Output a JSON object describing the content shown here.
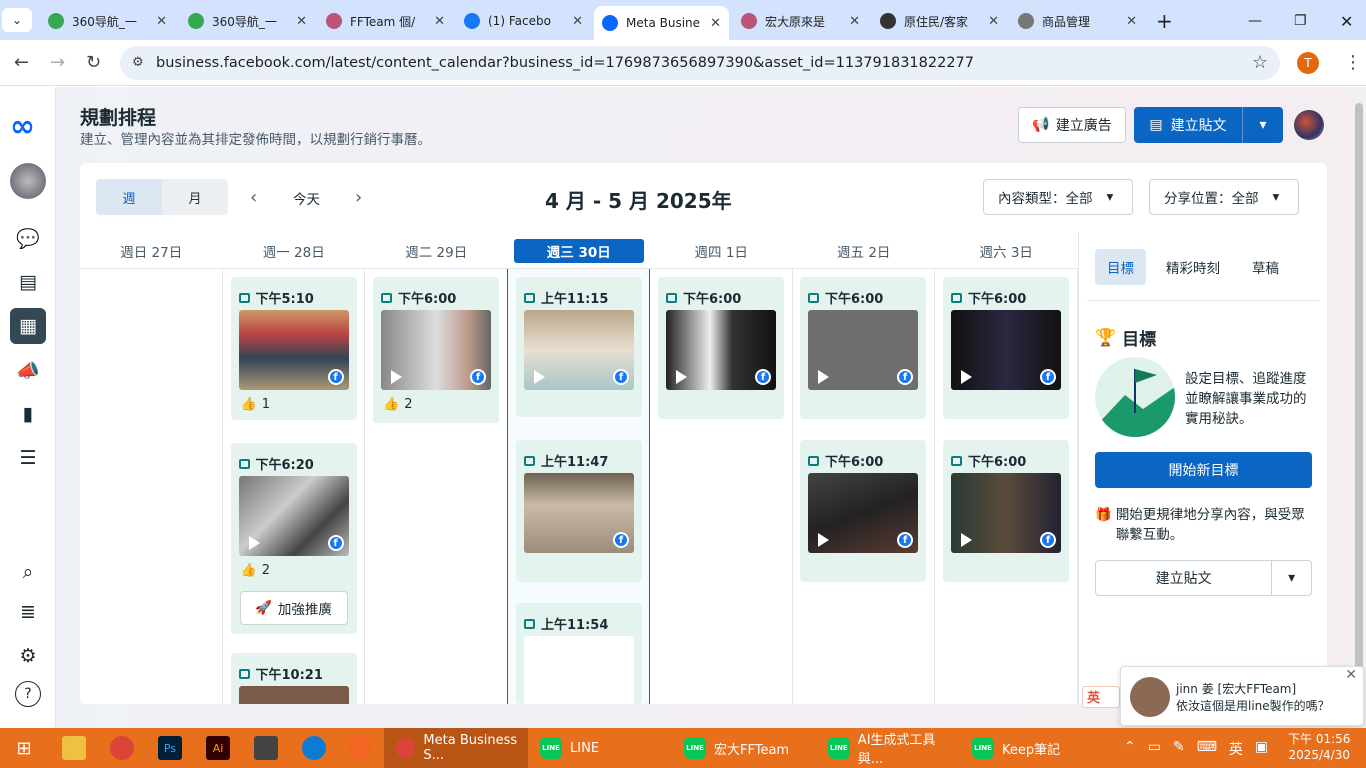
{
  "browser": {
    "tabs": [
      {
        "title": "360导航_一",
        "color": "#36a852"
      },
      {
        "title": "360导航_一",
        "color": "#36a852"
      },
      {
        "title": "FFTeam 個/",
        "color": "#b57"
      },
      {
        "title": "(1) Facebo",
        "color": "#1877f2"
      },
      {
        "title": "Meta Busine",
        "color": "#0866ff"
      },
      {
        "title": "宏大原來是",
        "color": "#b57"
      },
      {
        "title": "原住民/客家",
        "color": "#333"
      },
      {
        "title": "商品管理",
        "color": "#777"
      }
    ],
    "url": "business.facebook.com/latest/content_calendar?business_id=1769873656897390&asset_id=113791831822277",
    "profile_initial": "T"
  },
  "header": {
    "title": "規劃排程",
    "subtitle": "建立、管理內容並為其排定發佈時間，以規劃行銷行事曆。",
    "create_ad": "建立廣告",
    "create_post": "建立貼文"
  },
  "toolbar": {
    "view_week": "週",
    "view_month": "月",
    "today": "今天",
    "range": "4 月 - 5 月 2025年",
    "filter_type": "內容類型：全部",
    "filter_place": "分享位置：全部"
  },
  "days": [
    "週日 27日",
    "週一 28日",
    "週二 29日",
    "週三 30日",
    "週四 1日",
    "週五 2日",
    "週六 3日"
  ],
  "posts": {
    "mon1": {
      "time": "下午5:10",
      "likes": "1"
    },
    "mon2": {
      "time": "下午6:20",
      "likes": "2",
      "boost": "加強推廣"
    },
    "mon3": {
      "time": "下午10:21"
    },
    "tue1": {
      "time": "下午6:00",
      "likes": "2"
    },
    "wed1": {
      "time": "上午11:15"
    },
    "wed2": {
      "time": "上午11:47"
    },
    "wed3": {
      "time": "上午11:54"
    },
    "thu1": {
      "time": "下午6:00"
    },
    "fri1": {
      "time": "下午6:00"
    },
    "fri2": {
      "time": "下午6:00"
    },
    "sat1": {
      "time": "下午6:00"
    },
    "sat2": {
      "time": "下午6:00"
    }
  },
  "right_panel": {
    "tabs": [
      "目標",
      "精彩時刻",
      "草稿"
    ],
    "goal_heading": "目標",
    "goal_text": "設定目標、追蹤進度並瞭解讓事業成功的實用秘訣。",
    "start_goal": "開始新目標",
    "share_tip": "開始更規律地分享內容，與受眾聯繫互動。",
    "create_post": "建立貼文"
  },
  "chat": {
    "name": "jinn 姜 [宏大FFTeam]",
    "message": "依汝這個是用line製作的嗎？",
    "side_label": "英"
  },
  "taskbar": {
    "active": "Meta Business S...",
    "items": [
      "LINE",
      "宏大FFTeam",
      "AI生成式工具與...",
      "Keep筆記"
    ],
    "ime": "英",
    "time": "下午 01:56",
    "date": "2025/4/30"
  }
}
